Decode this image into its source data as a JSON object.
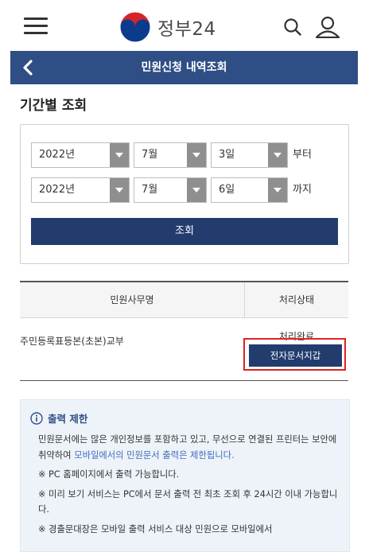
{
  "header": {
    "logo_text": "정부24"
  },
  "navbar": {
    "title": "민원신청 내역조회"
  },
  "section_title": "기간별 조회",
  "filter": {
    "from": {
      "year": "2022년",
      "month": "7월",
      "day": "3일",
      "suffix": "부터"
    },
    "to": {
      "year": "2022년",
      "month": "7월",
      "day": "6일",
      "suffix": "까지"
    },
    "query_label": "조회"
  },
  "table": {
    "headers": {
      "name": "민원사무명",
      "status": "처리상태"
    },
    "rows": [
      {
        "name": "주민등록표등본(초본)교부",
        "status": "처리완료",
        "action": "전자문서지갑"
      }
    ]
  },
  "notice": {
    "title": "출력 제한",
    "line1_pre": "민원문서에는 많은 개인정보를 포함하고 있고, 무선으로 연결된 프린터는 보안에 취약하여 ",
    "line1_hl": "모바일에서의 민원문서 출력은 제한됩니다.",
    "line2": "※ PC 홈페이지에서 출력 가능합니다.",
    "line3": "※ 미리 보기 서비스는 PC에서 문서 출력 전 최초 조회 후 24시간 이내 가능합니다.",
    "line4": "※ 경출문대장은 모바일 출력 서비스 대상 민원으로 모바일에서"
  },
  "colors": {
    "primary_navy": "#2f4e85",
    "button_navy": "#233c6e",
    "highlight_red": "#e0221f",
    "notice_bg": "#eef3f9",
    "link_blue": "#3f6dbd"
  },
  "icons": [
    "hamburger-icon",
    "government-logo-icon",
    "search-icon",
    "user-icon",
    "back-chevron-icon",
    "info-icon"
  ]
}
